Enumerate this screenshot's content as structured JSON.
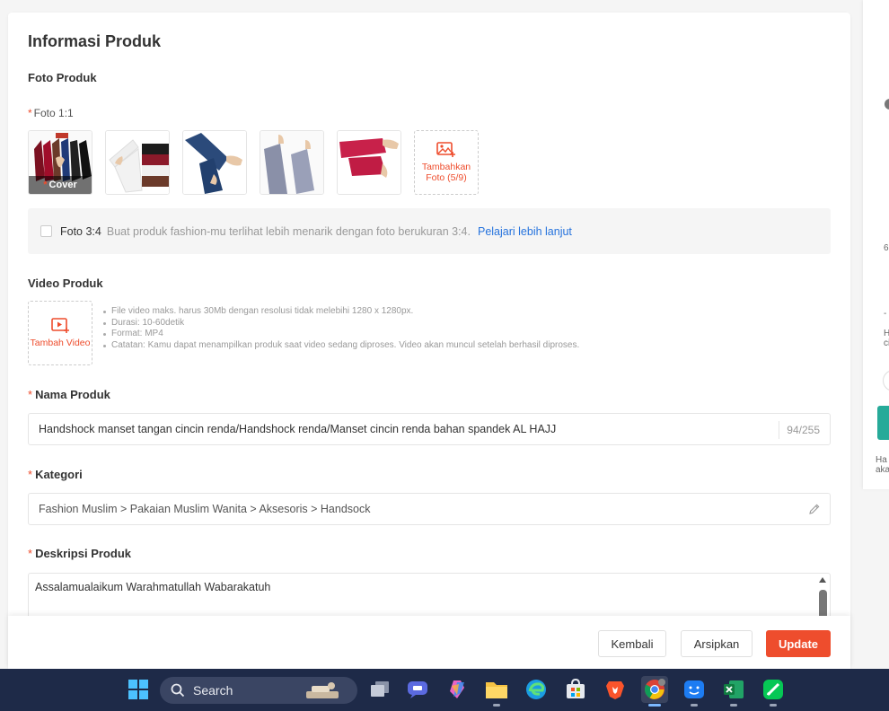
{
  "section": {
    "title": "Informasi Produk",
    "foto_produk_label": "Foto Produk",
    "foto_ratio_label": "Foto 1:1",
    "cover_label": "Cover",
    "add_photo_label": "Tambahkan Foto (5/9)",
    "foto34": {
      "label": "Foto 3:4",
      "description": "Buat produk fashion-mu terlihat lebih menarik dengan foto berukuran 3:4.",
      "link": "Pelajari lebih lanjut"
    },
    "video": {
      "label": "Video Produk",
      "add_label": "Tambah Video",
      "notes": [
        "File video maks. harus 30Mb dengan resolusi tidak melebihi 1280 x 1280px.",
        "Durasi: 10-60detik",
        "Format: MP4",
        "Catatan: Kamu dapat menampilkan produk saat video sedang diproses. Video akan muncul setelah berhasil diproses."
      ]
    },
    "nama_produk": {
      "label": "Nama Produk",
      "value": "Handshock manset tangan cincin renda/Handshock renda/Manset cincin renda bahan spandek AL HAJJ",
      "count": "94/255"
    },
    "kategori": {
      "label": "Kategori",
      "value": "Fashion Muslim > Pakaian Muslim Wanita > Aksesoris > Handsock"
    },
    "deskripsi": {
      "label": "Deskripsi Produk",
      "value": "Assalamualaikum Warahmatullah Wabarakatuh"
    }
  },
  "footer": {
    "back_label": "Kembali",
    "archive_label": "Arsipkan",
    "update_label": "Update"
  },
  "side_panel": {
    "texts": [
      "6",
      "-",
      "H",
      "ci",
      "Ha",
      "aka"
    ]
  },
  "taskbar": {
    "search_label": "Search",
    "apps": [
      "windows-start",
      "task-view",
      "chat",
      "copilot",
      "file-explorer",
      "edge",
      "store",
      "brave",
      "chrome",
      "finder",
      "excel",
      "line"
    ]
  },
  "colors": {
    "accent": "#ee4d2d",
    "link": "#2673dd",
    "taskbar": "#1e2a48"
  }
}
